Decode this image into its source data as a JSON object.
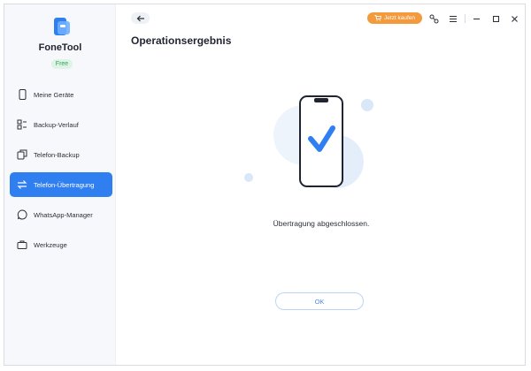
{
  "app": {
    "name": "FoneTool",
    "badge": "Free"
  },
  "sidebar": {
    "items": [
      {
        "label": "Meine Geräte",
        "icon": "phone-icon",
        "active": false
      },
      {
        "label": "Backup-Verlauf",
        "icon": "history-icon",
        "active": false
      },
      {
        "label": "Telefon-Backup",
        "icon": "backup-icon",
        "active": false
      },
      {
        "label": "Telefon-Übertragung",
        "icon": "transfer-icon",
        "active": true
      },
      {
        "label": "WhatsApp-Manager",
        "icon": "whatsapp-icon",
        "active": false
      },
      {
        "label": "Werkzeuge",
        "icon": "toolbox-icon",
        "active": false
      }
    ]
  },
  "topbar": {
    "buy_label": "Jetzt kaufen",
    "icons": [
      "back-arrow-icon",
      "key-icon",
      "menu-icon",
      "minimize-icon",
      "maximize-icon",
      "close-icon"
    ]
  },
  "main": {
    "title": "Operationsergebnis",
    "result": "Übertragung abgeschlossen.",
    "ok_label": "OK"
  },
  "colors": {
    "accent": "#2f7ff0",
    "buy": "#f39a3d",
    "free_badge": "#2ea45a"
  }
}
